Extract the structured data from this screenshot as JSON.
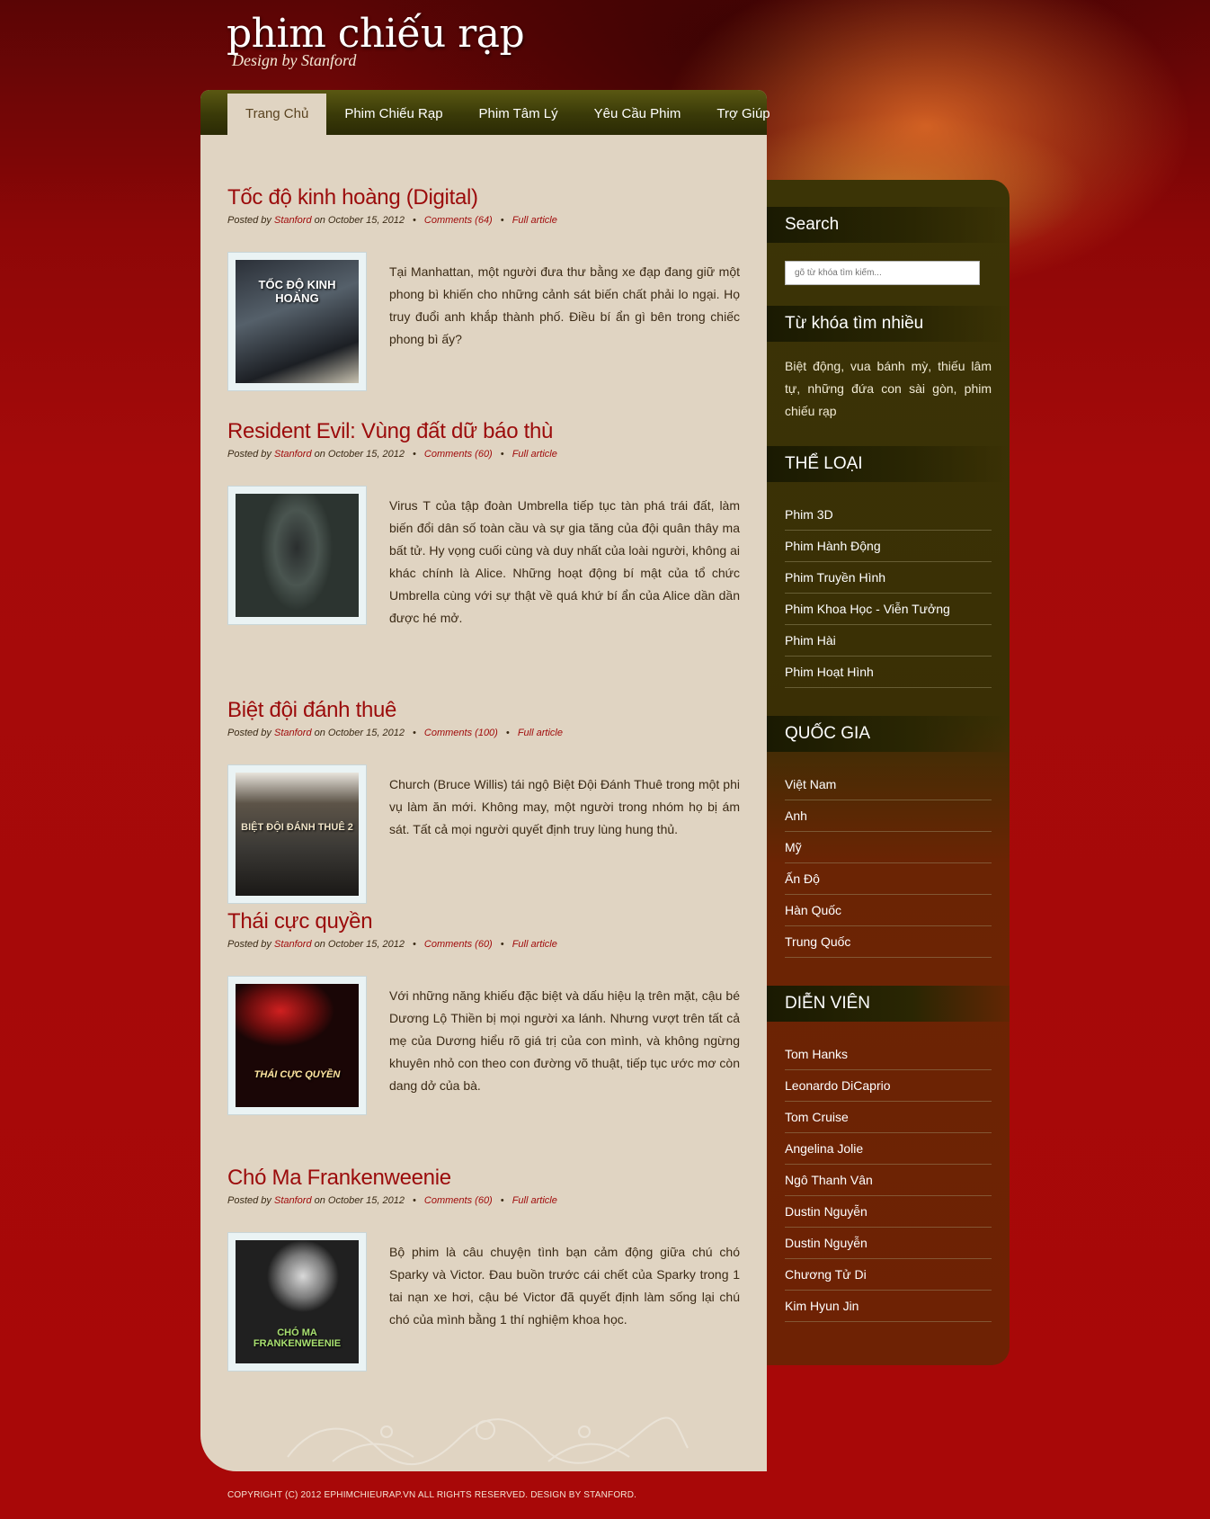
{
  "site": {
    "title": "phim chiếu rạp",
    "subtitle": "Design by Stanford"
  },
  "nav": {
    "items": [
      {
        "label": "Trang Chủ",
        "active": true
      },
      {
        "label": "Phim Chiếu Rạp",
        "active": false
      },
      {
        "label": "Phim Tâm Lý",
        "active": false
      },
      {
        "label": "Yêu Cầu Phim",
        "active": false
      },
      {
        "label": "Trợ Giúp",
        "active": false
      }
    ]
  },
  "posts": [
    {
      "title": "Tốc độ kinh hoàng (Digital)",
      "posted_by": "Posted by",
      "author": "Stanford",
      "date": "on October 15, 2012",
      "comments": "Comments (64)",
      "full": "Full article",
      "poster_caption": "TỐC ĐỘ KINH HOÀNG",
      "text": "Tại Manhattan, một người đưa thư bằng xe đạp đang giữ một phong bì khiến cho những cảnh sát biến chất phải lo ngại. Họ truy đuổi anh khắp thành phố. Điều bí ẩn gì bên trong chiếc phong bì ấy?"
    },
    {
      "title": "Resident Evil: Vùng đất dữ báo thù",
      "posted_by": "Posted by",
      "author": "Stanford",
      "date": "on October 15, 2012",
      "comments": "Comments (60)",
      "full": "Full article",
      "poster_caption": "",
      "text": "Virus T của tập đoàn Umbrella tiếp tục tàn phá trái đất, làm biến đổi dân số toàn cầu và sự gia tăng của đội quân thây ma bất tử. Hy vọng cuối cùng và duy nhất của loài người, không ai khác chính là Alice. Những hoạt động bí mật của tổ chức Umbrella cùng với sự thật về quá khứ bí ẩn của Alice dần dần được hé mở."
    },
    {
      "title": "Biệt đội đánh thuê",
      "posted_by": "Posted by",
      "author": "Stanford",
      "date": "on October 15, 2012",
      "comments": "Comments (100)",
      "full": "Full article",
      "poster_caption": "BIỆT ĐỘI ĐÁNH THUÊ 2",
      "text": "Church (Bruce Willis) tái ngộ Biệt Đội Đánh Thuê trong một phi vụ làm ăn mới. Không may, một người trong nhóm họ bị ám sát. Tất cả mọi người quyết định truy lùng hung thủ."
    },
    {
      "title": "Thái cực quyền",
      "posted_by": "Posted by",
      "author": "Stanford",
      "date": "on October 15, 2012",
      "comments": "Comments (60)",
      "full": "Full article",
      "poster_caption": "THÁI CỰC QUYỀN",
      "text": "Với những năng khiếu đặc biệt và dấu hiệu lạ trên mặt, cậu bé Dương Lộ Thiền bị mọi người xa lánh. Nhưng vượt trên tất cả mẹ của Dương hiểu rõ giá trị của con mình, và không ngừng khuyên nhỏ con theo con đường võ thuật, tiếp tục ước mơ còn dang dở của bà."
    },
    {
      "title": "Chó Ma Frankenweenie",
      "posted_by": "Posted by",
      "author": "Stanford",
      "date": "on October 15, 2012",
      "comments": "Comments (60)",
      "full": "Full article",
      "poster_caption": "CHÓ MA FRANKENWEENIE",
      "text": "Bộ phim là câu chuyện tình bạn cảm động giữa chú chó Sparky và Victor. Đau buồn trước cái chết của Sparky trong 1 tai nạn xe hơi, cậu bé Victor đã quyết định làm sống lại chú chó của mình bằng 1 thí nghiệm khoa học."
    }
  ],
  "sidebar": {
    "search": {
      "heading": "Search",
      "placeholder": "gõ từ khóa tìm kiếm..."
    },
    "popular": {
      "heading": "Từ khóa tìm nhiều",
      "text": "Biệt động, vua bánh mỳ, thiếu lâm tự, những đứa con sài gòn, phim chiếu rạp"
    },
    "genres": {
      "heading": "THỂ LOẠI",
      "items": [
        "Phim 3D",
        "Phim Hành Động",
        "Phim Truyền Hình",
        "Phim Khoa Học - Viễn Tưởng",
        "Phim Hài",
        "Phim Hoạt Hình"
      ]
    },
    "countries": {
      "heading": "QUỐC GIA",
      "items": [
        "Việt Nam",
        "Anh",
        "Mỹ",
        "Ấn Độ",
        "Hàn Quốc",
        "Trung Quốc"
      ]
    },
    "actors": {
      "heading": "DIỄN VIÊN",
      "items": [
        "Tom Hanks",
        "Leonardo DiCaprio",
        "Tom Cruise",
        "Angelina Jolie",
        "Ngô Thanh Vân",
        "Dustin Nguyễn",
        "Dustin Nguyễn",
        "Chương Tử Di",
        "Kim Hyun Jin"
      ]
    }
  },
  "footer": {
    "text": "COPYRIGHT (C) 2012 EPHIMCHIEURAP.VN ALL RIGHTS RESERVED. DESIGN BY STANFORD."
  },
  "colors": {
    "accent_red": "#9b0b0b",
    "panel": "#e0d4c2",
    "nav_olive": "#3a3a08"
  }
}
